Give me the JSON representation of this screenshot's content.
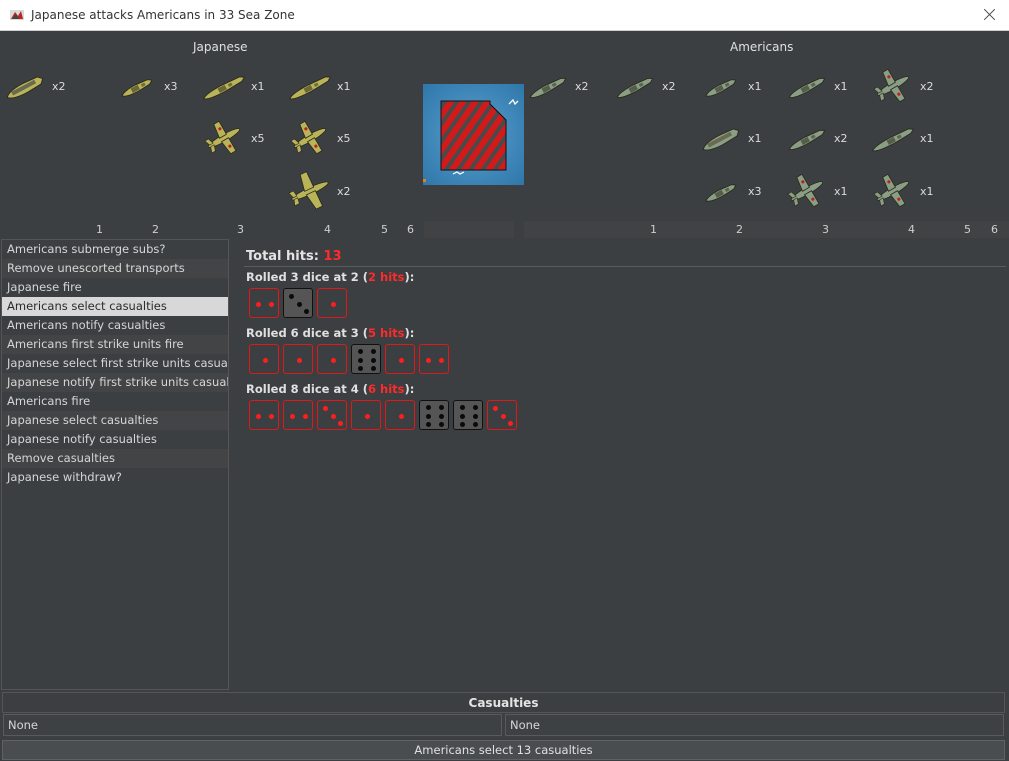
{
  "window": {
    "title": "Japanese attacks Americans in 33 Sea Zone"
  },
  "attacker": {
    "name": "Japanese",
    "color": "#b9b35a",
    "units": [
      {
        "type": "carrier",
        "count": "x2"
      },
      {
        "type": "destroyer",
        "count": "x3"
      },
      {
        "type": "battleship",
        "count": "x1"
      },
      {
        "type": "battleship-long",
        "count": "x1"
      },
      {
        "type": "fighter",
        "count": "x5"
      },
      {
        "type": "fighter-dark",
        "count": "x5"
      },
      {
        "type": "bomber",
        "count": "x2"
      }
    ],
    "die_numbers": [
      "1",
      "2",
      "3",
      "4",
      "5",
      "6"
    ]
  },
  "defender": {
    "name": "Americans",
    "color": "#8a9e86",
    "units": [
      {
        "type": "transport",
        "count": "x2"
      },
      {
        "type": "submarine",
        "count": "x2"
      },
      {
        "type": "destroyer",
        "count": "x1"
      },
      {
        "type": "cruiser",
        "count": "x1"
      },
      {
        "type": "fighter",
        "count": "x2"
      },
      {
        "type": "carrier",
        "count": "x1"
      },
      {
        "type": "cruiser",
        "count": "x2"
      },
      {
        "type": "battleship",
        "count": "x1"
      },
      {
        "type": "destroyer",
        "count": "x3"
      },
      {
        "type": "fighter",
        "count": "x1"
      },
      {
        "type": "fighter",
        "count": "x1"
      }
    ],
    "die_numbers": [
      "1",
      "2",
      "3",
      "4",
      "5",
      "6"
    ]
  },
  "steps": [
    "Americans submerge subs?",
    "Remove unescorted transports",
    "Japanese fire",
    "Americans select casualties",
    "Americans notify casualties",
    "Americans first strike units fire",
    "Japanese select first strike units casualties",
    "Japanese notify first strike units casualties",
    "Americans fire",
    "Japanese select casualties",
    "Japanese notify casualties",
    "Remove casualties",
    "Japanese withdraw?"
  ],
  "selected_step": 3,
  "dice": {
    "total_label": "Total hits:",
    "total_hits": "13",
    "rolls": [
      {
        "prefix": "Rolled 3 dice at 2 (",
        "hits": "2 hits",
        "suffix": "):",
        "dice": [
          2,
          3,
          1
        ],
        "hit_threshold": 2
      },
      {
        "prefix": "Rolled 6 dice at 3 (",
        "hits": "5 hits",
        "suffix": "):",
        "dice": [
          1,
          1,
          1,
          6,
          1,
          2
        ],
        "hit_threshold": 3
      },
      {
        "prefix": "Rolled 8 dice at 4 (",
        "hits": "6 hits",
        "suffix": "):",
        "dice": [
          2,
          2,
          3,
          1,
          1,
          6,
          6,
          3
        ],
        "hit_threshold": 4
      }
    ]
  },
  "casualties": {
    "header": "Casualties",
    "left": "None",
    "right": "None"
  },
  "status": "Americans select 13 casualties",
  "colors": {
    "hit": "#ff1e1e",
    "background": "#3c3f41",
    "terrain_water": "#3a86b8",
    "territory_hatch": "#d21a1a"
  }
}
